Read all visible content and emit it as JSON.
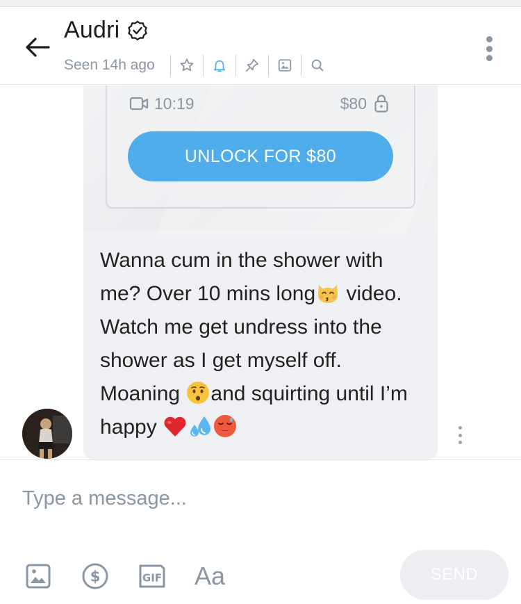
{
  "header": {
    "name": "Audri",
    "verified_icon": "verified-badge-icon",
    "seen": "Seen 14h ago",
    "icons": [
      "star-icon",
      "bell-icon",
      "pin-icon",
      "image-icon",
      "search-icon"
    ]
  },
  "message": {
    "media": {
      "duration": "10:19",
      "price": "$80",
      "unlock_label": "UNLOCK FOR $80"
    },
    "text_parts": [
      "Wanna cum in the shower with me? Over 10 mins long",
      " video. Watch me get undress into the shower as I get myself off. Moaning ",
      "and squirting until I’m happy "
    ],
    "emojis": [
      "kissing-cat-emoji",
      "hushed-face-emoji",
      "red-heart-emoji",
      "sweat-droplets-emoji",
      "hot-face-emoji"
    ]
  },
  "composer": {
    "placeholder": "Type a message...",
    "send_label": "SEND",
    "font_toggle_label": "Aa"
  },
  "colors": {
    "accent": "#4fadec",
    "muted": "#8a96a3",
    "bubble": "#eef0f3"
  }
}
